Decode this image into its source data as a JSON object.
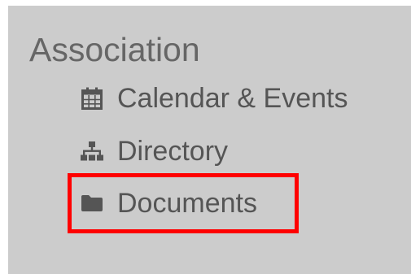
{
  "sidebar": {
    "section_title": "Association",
    "items": [
      {
        "label": "Calendar & Events",
        "icon": "calendar-icon"
      },
      {
        "label": "Directory",
        "icon": "sitemap-icon"
      },
      {
        "label": "Documents",
        "icon": "folder-icon"
      }
    ]
  },
  "colors": {
    "panel_background": "#cccccc",
    "text": "#555555",
    "heading_text": "#666666",
    "highlight": "#ff0000"
  }
}
